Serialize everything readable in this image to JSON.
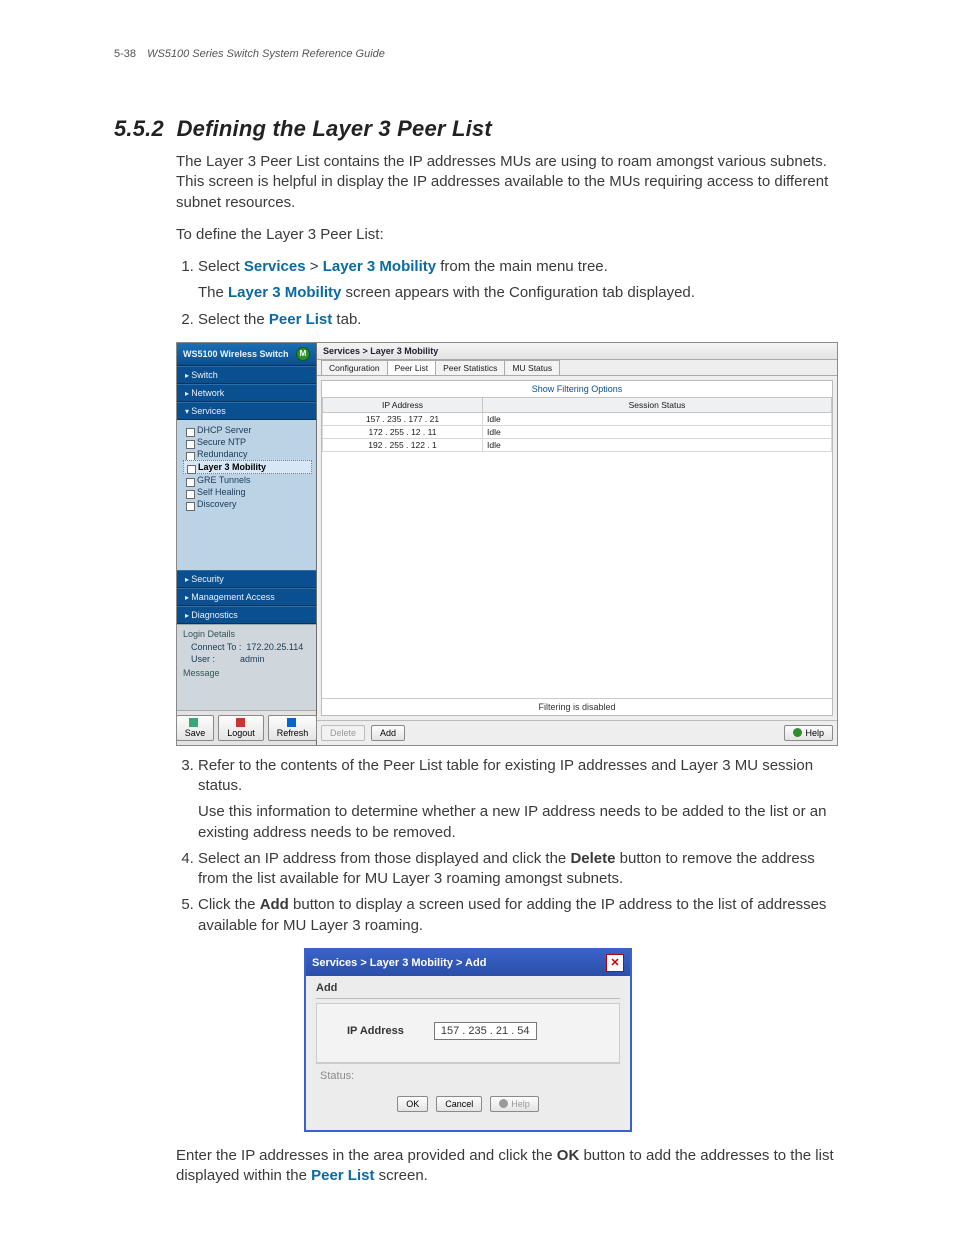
{
  "page_header": {
    "num": "5-38",
    "title": "WS5100 Series Switch System Reference Guide"
  },
  "section": {
    "num": "5.5.2",
    "title": "Defining the Layer 3 Peer List"
  },
  "intro": "The Layer 3 Peer List contains the IP addresses MUs are using to roam amongst various subnets. This screen is helpful in display the IP addresses available to the MUs requiring access to different subnet resources.",
  "lead": "To define the Layer 3 Peer List:",
  "steps": {
    "s1_a": "Select ",
    "s1_kw1": "Services",
    "s1_sep": " > ",
    "s1_kw2": "Layer 3 Mobility",
    "s1_b": " from the main menu tree.",
    "s1_sub_a": "The ",
    "s1_sub_kw": "Layer 3 Mobility",
    "s1_sub_b": " screen appears with the Configuration tab displayed.",
    "s2_a": "Select the ",
    "s2_kw": "Peer List",
    "s2_b": " tab.",
    "s3": "Refer to the contents of the Peer List table for existing IP addresses and Layer 3 MU session status.",
    "s3_sub": "Use this information to determine whether a new IP address needs to be added to the list or an existing address needs to be removed.",
    "s4_a": "Select an IP address from those displayed and click the ",
    "s4_kw": "Delete",
    "s4_b": " button to remove the address from the list available for MU Layer 3 roaming amongst subnets.",
    "s5_a": "Click the ",
    "s5_kw": "Add",
    "s5_b": " button to display a screen used for adding the IP address to the list of addresses available for MU Layer 3 roaming."
  },
  "closing_a": "Enter the IP addresses in the area provided and click the ",
  "closing_kw": "OK",
  "closing_b": " button to add the addresses to the list displayed within the ",
  "closing_kw2": "Peer List",
  "closing_c": " screen.",
  "screenshot1": {
    "app_title": "WS5100 Wireless Switch",
    "logo_text": "M",
    "nav": {
      "switch": "Switch",
      "network": "Network",
      "services": "Services",
      "security": "Security",
      "mgmt": "Management Access",
      "diag": "Diagnostics"
    },
    "tree": {
      "dhcp": "DHCP Server",
      "ntp": "Secure NTP",
      "red": "Redundancy",
      "l3m": "Layer 3 Mobility",
      "gre": "GRE Tunnels",
      "sh": "Self Healing",
      "disc": "Discovery"
    },
    "login": {
      "heading": "Login Details",
      "connect_lbl": "Connect To :",
      "connect_val": "172.20.25.114",
      "user_lbl": "User :",
      "user_val": "admin",
      "message_lbl": "Message"
    },
    "footer": {
      "save": "Save",
      "logout": "Logout",
      "refresh": "Refresh"
    },
    "crumb": "Services > Layer 3 Mobility",
    "tabs": {
      "cfg": "Configuration",
      "peer": "Peer List",
      "stats": "Peer Statistics",
      "mu": "MU Status"
    },
    "filter_link": "Show Filtering Options",
    "cols": {
      "ip": "IP Address",
      "sess": "Session Status"
    },
    "rows": [
      {
        "ip": "157  .  235  .  177  .  21",
        "sess": "Idle"
      },
      {
        "ip": "172  .  255  .  12  .  11",
        "sess": "Idle"
      },
      {
        "ip": "192  .  255  .  122  .  1",
        "sess": "Idle"
      }
    ],
    "filter_status": "Filtering is disabled",
    "toolbar": {
      "del": "Delete",
      "add": "Add",
      "help": "Help"
    }
  },
  "dialog": {
    "title": "Services > Layer 3 Mobility > Add",
    "heading": "Add",
    "field_label": "IP Address",
    "field_value": "157 . 235 . 21  .  54",
    "status_label": "Status:",
    "ok": "OK",
    "cancel": "Cancel",
    "help": "Help"
  }
}
